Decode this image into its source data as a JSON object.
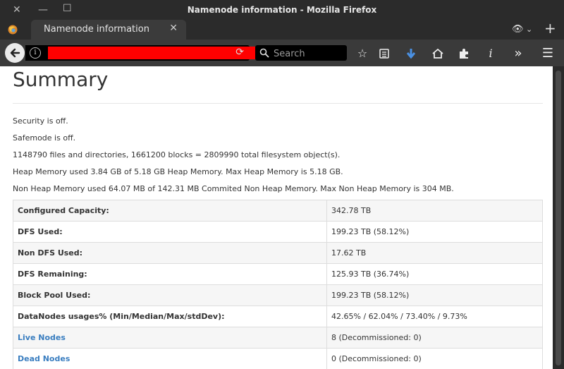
{
  "window": {
    "title": "Namenode information - Mozilla Firefox"
  },
  "tab": {
    "title": "Namenode information"
  },
  "search": {
    "placeholder": "Search"
  },
  "page": {
    "heading": "Summary",
    "lines": [
      "Security is off.",
      "Safemode is off.",
      "1148790 files and directories, 1661200 blocks = 2809990 total filesystem object(s).",
      "Heap Memory used 3.84 GB of 5.18 GB Heap Memory. Max Heap Memory is 5.18 GB.",
      "Non Heap Memory used 64.07 MB of 142.31 MB Commited Non Heap Memory. Max Non Heap Memory is 304 MB."
    ],
    "table": [
      {
        "key": "Configured Capacity:",
        "value": "342.78 TB"
      },
      {
        "key": "DFS Used:",
        "value": "199.23 TB (58.12%)"
      },
      {
        "key": "Non DFS Used:",
        "value": "17.62 TB"
      },
      {
        "key": "DFS Remaining:",
        "value": "125.93 TB (36.74%)"
      },
      {
        "key": "Block Pool Used:",
        "value": "199.23 TB (58.12%)"
      },
      {
        "key": "DataNodes usages% (Min/Median/Max/stdDev):",
        "value": "42.65% / 62.04% / 73.40% / 9.73%"
      },
      {
        "key": "Live Nodes",
        "value": "8 (Decommissioned: 0)"
      },
      {
        "key": "Dead Nodes",
        "value": "0 (Decommissioned: 0)"
      }
    ]
  },
  "colors": {
    "link": "#3a7ec0",
    "redaction": "#ff0000",
    "download_arrow": "#4a90e2"
  }
}
